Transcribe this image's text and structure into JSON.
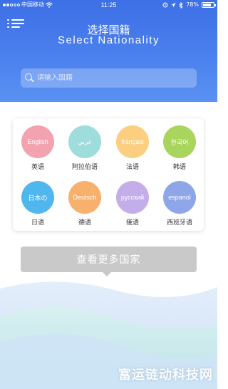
{
  "status_bar": {
    "carrier": "中国移动",
    "time": "11:25",
    "battery": "78%",
    "battery_level": 0.78
  },
  "header": {
    "title_cn": "选择国籍",
    "title_en": "Select Nationality"
  },
  "search": {
    "placeholder": "请输入国籍",
    "value": ""
  },
  "languages": [
    {
      "badge": "English",
      "label": "英语",
      "color": "#f3a3b0"
    },
    {
      "badge": "ﻋﺮﺑﻲ",
      "label": "阿拉伯语",
      "color": "#9fdcdc"
    },
    {
      "badge": "français",
      "label": "法语",
      "color": "#fbcf7f"
    },
    {
      "badge": "한국어",
      "label": "韩语",
      "color": "#a9d45e"
    },
    {
      "badge": "日本の",
      "label": "日语",
      "color": "#4fb6ee"
    },
    {
      "badge": "Deutsch",
      "label": "德语",
      "color": "#f8b06d"
    },
    {
      "badge": "русский",
      "label": "俄语",
      "color": "#c4aeea"
    },
    {
      "badge": "espanol",
      "label": "西班牙语",
      "color": "#8ea5e8"
    }
  ],
  "more_button": {
    "label": "查看更多国家"
  },
  "watermark": "富运链动科技网",
  "colors": {
    "header_top": "#3d6fe6",
    "header_bottom": "#5a92f2",
    "button_gray": "#c9c9c9"
  }
}
